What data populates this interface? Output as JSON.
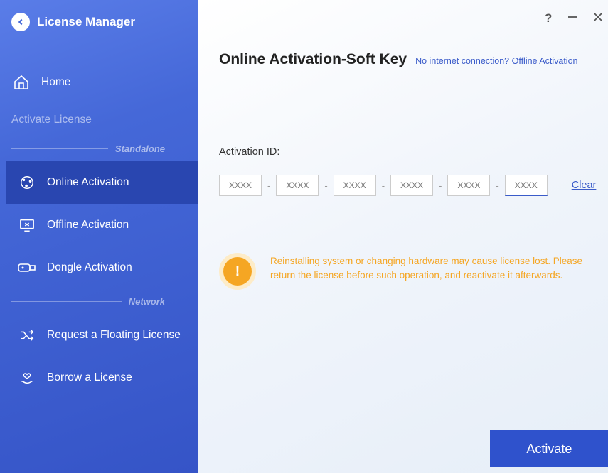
{
  "app": {
    "title": "License Manager"
  },
  "sidebar": {
    "home": "Home",
    "activate_heading": "Activate License",
    "standalone_label": "Standalone",
    "network_label": "Network",
    "online": "Online Activation",
    "offline": "Offline Activation",
    "dongle": "Dongle Activation",
    "request_floating": "Request a Floating License",
    "borrow": "Borrow a License"
  },
  "main": {
    "page_title": "Online Activation-Soft Key",
    "offline_link": "No internet connection? Offline Activation",
    "field_label": "Activation ID:",
    "key_placeholder": "XXXX",
    "clear": "Clear",
    "warning": "Reinstalling system or changing hardware may cause license lost. Please return the license before such operation, and reactivate it afterwards.",
    "activate": "Activate"
  }
}
